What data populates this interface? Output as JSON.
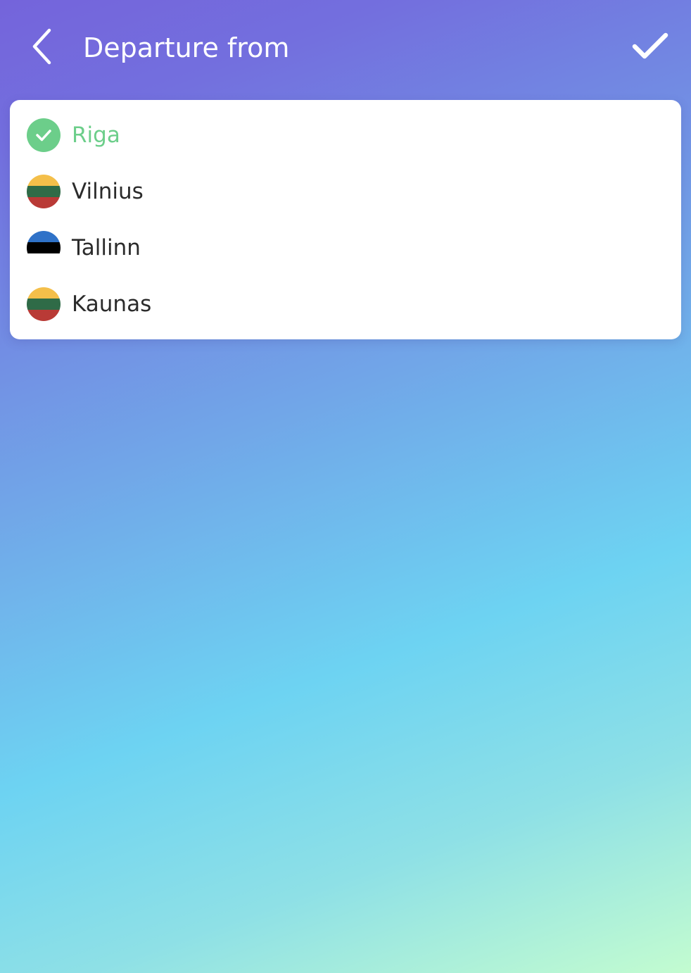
{
  "header": {
    "title": "Departure from",
    "back_icon": "chevron-left-icon",
    "confirm_icon": "checkmark-icon"
  },
  "options": [
    {
      "label": "Riga",
      "selected": true,
      "icon": "check-circle-icon"
    },
    {
      "label": "Vilnius",
      "selected": false,
      "icon": "lithuania-flag-icon",
      "flag_colors": [
        "#f4bf4a",
        "#2f6b47",
        "#b93a36"
      ]
    },
    {
      "label": "Tallinn",
      "selected": false,
      "icon": "estonia-flag-icon",
      "flag_colors": [
        "#2f72c8",
        "#000000",
        "#ffffff"
      ]
    },
    {
      "label": "Kaunas",
      "selected": false,
      "icon": "lithuania-flag-icon",
      "flag_colors": [
        "#f4bf4a",
        "#2f6b47",
        "#b93a36"
      ]
    }
  ],
  "colors": {
    "selected": "#6cce8a",
    "text": "#2b2b2b",
    "header_text": "#ffffff"
  }
}
